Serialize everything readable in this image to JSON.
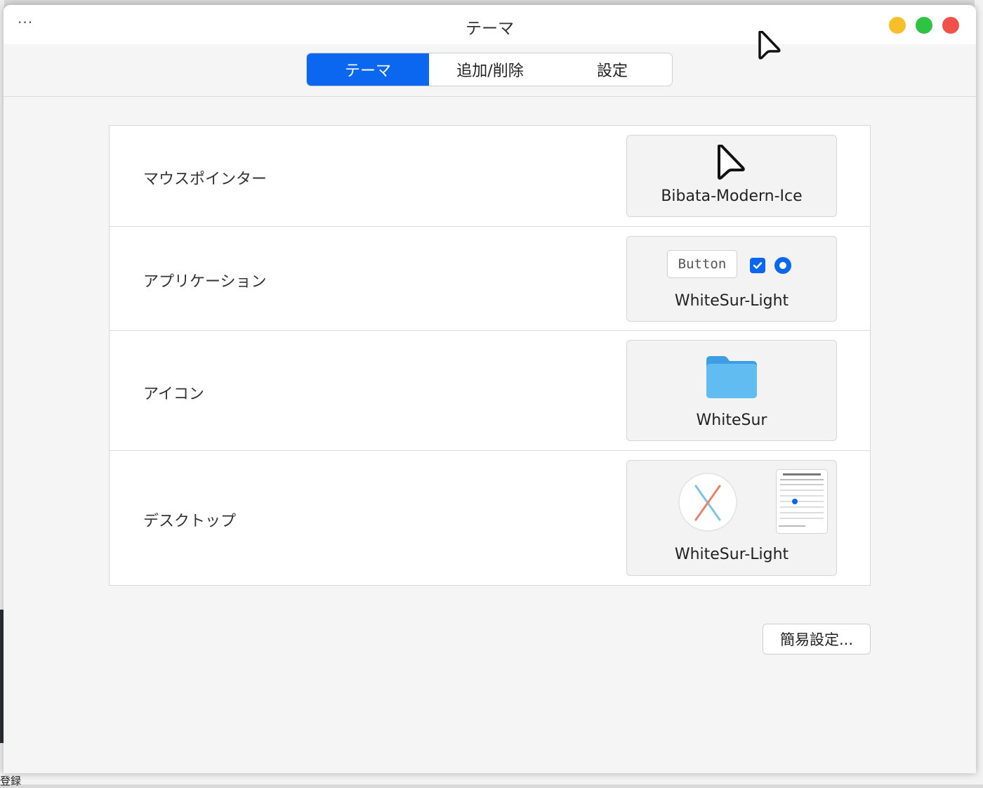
{
  "window": {
    "title": "テーマ",
    "menu_label": "···"
  },
  "tabs": [
    {
      "label": "テーマ",
      "active": true
    },
    {
      "label": "追加/削除",
      "active": false
    },
    {
      "label": "設定",
      "active": false
    }
  ],
  "rows": [
    {
      "label": "マウスポインター",
      "value": "Bibata-Modern-Ice",
      "preview_icon": "pointer-cursor-icon"
    },
    {
      "label": "アプリケーション",
      "value": "WhiteSur-Light",
      "preview_button_text": "Button"
    },
    {
      "label": "アイコン",
      "value": "WhiteSur",
      "preview_icon": "folder-icon"
    },
    {
      "label": "デスクトップ",
      "value": "WhiteSur-Light",
      "preview_icon": "macos-x-logo-icon"
    }
  ],
  "easy_settings_label": "簡易設定...",
  "background": {
    "bottom_text": "登録"
  },
  "colors": {
    "accent": "#0b67f0",
    "traffic_minimize": "#f7bf2a",
    "traffic_maximize": "#2ec343",
    "traffic_close": "#f2504b",
    "folder": "#56b3ec"
  }
}
